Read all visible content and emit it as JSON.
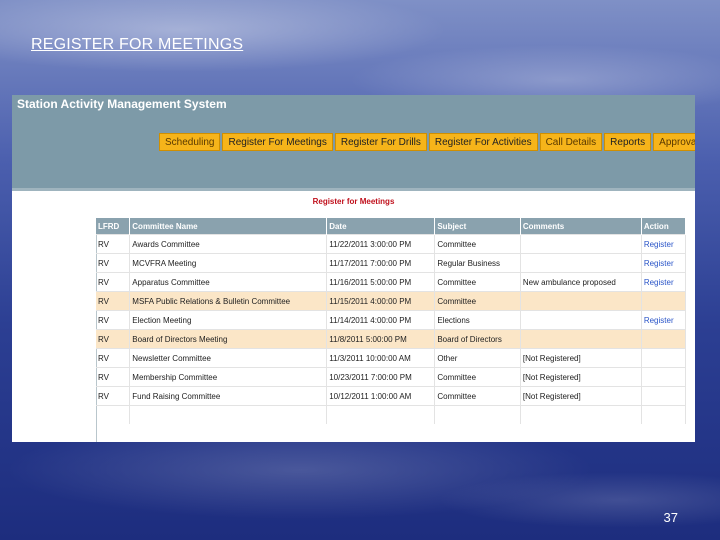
{
  "slide": {
    "title": "REGISTER FOR MEETINGS",
    "number": "37"
  },
  "app": {
    "title": "Station Activity Management System",
    "nav": [
      {
        "label": "Scheduling"
      },
      {
        "label": "Register For Meetings"
      },
      {
        "label": "Register For Drills"
      },
      {
        "label": "Register For Activities"
      },
      {
        "label": "Call Details"
      },
      {
        "label": "Reports"
      },
      {
        "label": "Approvals"
      }
    ],
    "section_title": "Register for Meetings",
    "table": {
      "headers": [
        "LFRD",
        "Committee Name",
        "Date",
        "Subject",
        "Comments",
        "Action"
      ],
      "rows": [
        [
          "RV",
          "Awards Committee",
          "11/22/2011 3:00:00 PM",
          "Committee",
          "",
          "Register"
        ],
        [
          "RV",
          "MCVFRA Meeting",
          "11/17/2011 7:00:00 PM",
          "Regular Business",
          "",
          "Register"
        ],
        [
          "RV",
          "Apparatus Committee",
          "11/16/2011 5:00:00 PM",
          "Committee",
          "New ambulance proposed",
          "Register"
        ],
        [
          "RV",
          "MSFA Public Relations & Bulletin Committee",
          "11/15/2011 4:00:00 PM",
          "Committee",
          "",
          ""
        ],
        [
          "RV",
          "Election Meeting",
          "11/14/2011 4:00:00 PM",
          "Elections",
          "",
          "Register"
        ],
        [
          "RV",
          "Board of Directors Meeting",
          "11/8/2011 5:00:00 PM",
          "Board of Directors",
          "",
          ""
        ],
        [
          "RV",
          "Newsletter Committee",
          "11/3/2011 10:00:00 AM",
          "Other",
          "[Not Registered]",
          ""
        ],
        [
          "RV",
          "Membership Committee",
          "10/23/2011 7:00:00 PM",
          "Committee",
          "[Not Registered]",
          ""
        ],
        [
          "RV",
          "Fund Raising Committee",
          "10/12/2011 1:00:00 AM",
          "Committee",
          "[Not Registered]",
          ""
        ]
      ],
      "highlighted_rows": [
        3,
        5
      ]
    }
  }
}
